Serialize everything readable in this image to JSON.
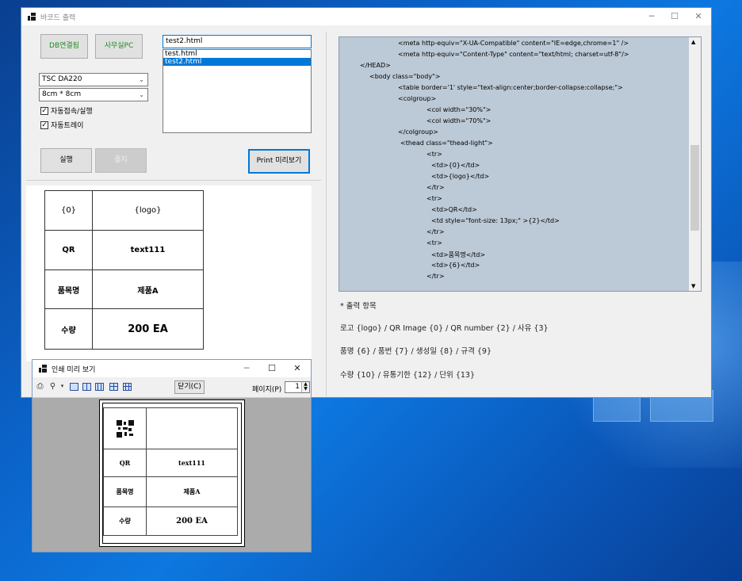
{
  "main_window": {
    "title": "바코드 출력",
    "controls": {
      "minimize": "─",
      "maximize": "☐",
      "close": "✕"
    }
  },
  "left_panel": {
    "db_button": "DB연결됨",
    "office_pc_button": "사무실PC",
    "file_input_value": "test2.html",
    "file_list": [
      "test.html",
      "test2.html"
    ],
    "selected_file": "test2.html",
    "printer_select": "TSC DA220",
    "size_select": "8cm * 8cm",
    "auto_connect_label": "자동접속/실행",
    "auto_tray_label": "자동트레이",
    "check_mark": "✓",
    "run_button": "실행",
    "stop_button": "중지",
    "print_preview_button": "Print 미리보기"
  },
  "label_preview": {
    "rows": [
      {
        "label": "{0}",
        "value": "{logo}"
      },
      {
        "label": "QR",
        "value": "text111"
      },
      {
        "label": "품목명",
        "value": "제품A"
      },
      {
        "label": "수량",
        "value": "200 EA"
      }
    ]
  },
  "code_view": {
    "lines": [
      "<meta http-equiv=\"X-UA-Compatible\" content=\"IE=edge,chrome=1\" />",
      "<meta http-equiv=\"Content-Type\" content=\"text/html; charset=utf-8\"/>",
      "</HEAD>",
      "<body class=\"body\">",
      "<table border='1' style=\"text-align:center;border-collapse:collapse;\">",
      "<colgroup>",
      "<col width=\"30%\">",
      "<col width=\"70%\">",
      "</colgroup>",
      "<thead class=\"thead-light\">",
      "<tr>",
      "<td>{0}</td>",
      "<td>{logo}</td>",
      "</tr>",
      "<tr>",
      "<td>QR</td>",
      "<td style=\"font-size: 13px;\" >{2}</td>",
      "</tr>",
      "<tr>",
      "<td>품목명</td>",
      "<td>{6}</td>",
      "</tr>"
    ],
    "scroll_up": "▲",
    "scroll_down": "▼"
  },
  "output_items": {
    "header": "* 출력 항목",
    "line1": "로고 {logo} / QR Image {0}  / QR number {2}  /  사유 {3}",
    "line2": "품명 {6}  / 품번 {7}  / 생성일 {8}  / 규격 {9}",
    "line3": "수량 {10}  / 유통기한 {12}  / 단위 {13}"
  },
  "print_preview": {
    "title": "인쇄 미리 보기",
    "close_button": "닫기(C)",
    "page_label": "페이지(P)",
    "page_value": "1",
    "print_icon": "⎙",
    "zoom_icon": "⚲",
    "rows": [
      {
        "label": "QR",
        "value": "text111"
      },
      {
        "label": "품목명",
        "value": "제품A"
      },
      {
        "label": "수량",
        "value": "200 EA"
      }
    ]
  },
  "colors": {
    "selection": "#0078d7",
    "code_background": "#bcc9d6",
    "green_button_text": "#1e8a1e"
  }
}
